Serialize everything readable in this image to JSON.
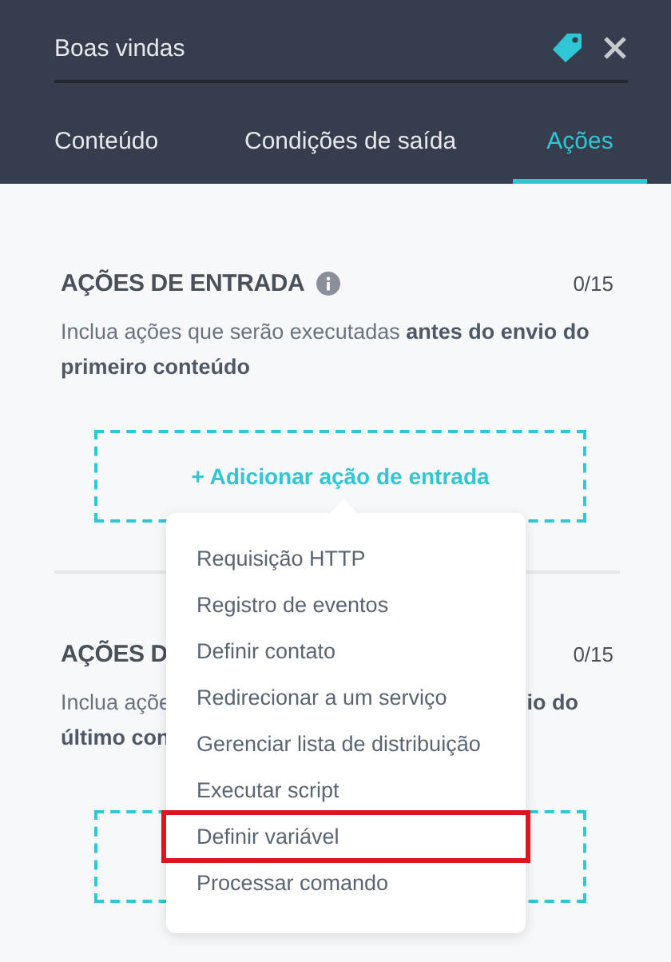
{
  "header": {
    "title": "Boas vindas"
  },
  "tabs": [
    {
      "label": "Conteúdo",
      "selected": false
    },
    {
      "label": "Condições de saída",
      "selected": false
    },
    {
      "label": "Ações",
      "selected": true
    }
  ],
  "sections": [
    {
      "title": "AÇÕES DE ENTRADA",
      "count": "0/15",
      "description": "Inclua ações que serão executadas **antes do envio do primeiro conteúdo**",
      "add_label": "+ Adicionar ação de entrada"
    },
    {
      "title": "AÇÕES D",
      "count": "0/15",
      "description_parts": [
        "Inclua açõe",
        "**io do**",
        "**último con**"
      ]
    }
  ],
  "menu": {
    "items": [
      {
        "label": "Requisição HTTP",
        "selected": false
      },
      {
        "label": "Registro de eventos",
        "selected": false
      },
      {
        "label": "Definir contato",
        "selected": false
      },
      {
        "label": "Redirecionar a um serviço",
        "selected": false
      },
      {
        "label": "Gerenciar lista de distribuição",
        "selected": false
      },
      {
        "label": "Executar script",
        "selected": false
      },
      {
        "label": "Definir variável",
        "selected": true
      },
      {
        "label": "Processar comando",
        "selected": false
      }
    ]
  }
}
